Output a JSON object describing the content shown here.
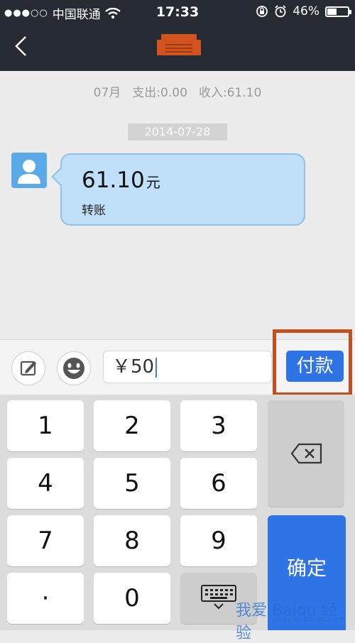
{
  "status_bar": {
    "signal_dots": "●●●○○",
    "carrier": "中国联通",
    "time": "17:33",
    "battery": "46%",
    "battery_fraction": 0.46
  },
  "nav": {
    "back_icon": "chevron-left-icon",
    "logo_icon": "card-logo-icon"
  },
  "summary": {
    "month": "07月",
    "expense": "支出:0.00",
    "income": "收入:61.10"
  },
  "message": {
    "date": "2014-07-28",
    "amount": "61.10",
    "unit": "元",
    "label": "转账"
  },
  "input_bar": {
    "value": "￥50",
    "pay_label": "付款"
  },
  "keypad": {
    "keys": [
      "1",
      "2",
      "3",
      "4",
      "5",
      "6",
      "7",
      "8",
      "9",
      "·",
      "0"
    ],
    "confirm_label": "确定"
  },
  "watermark": {
    "text": "我爱 Baidu 经验",
    "url": "jingyan.baidu.com"
  },
  "colors": {
    "accent": "#2f74e6",
    "highlight": "#c0501e",
    "topbar": "#262b33",
    "bubble": "#bfe0f8"
  }
}
